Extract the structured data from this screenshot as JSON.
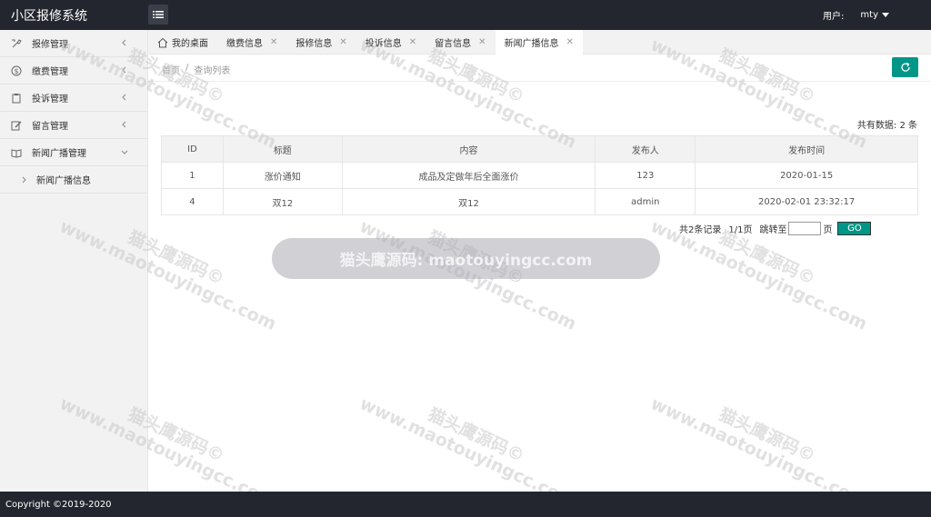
{
  "header": {
    "title": "小区报修系统",
    "user_label": "用户:",
    "user_name": "mty"
  },
  "sidebar": {
    "items": [
      {
        "label": "报修管理",
        "icon": "wrench-icon"
      },
      {
        "label": "缴费管理",
        "icon": "dollar-icon"
      },
      {
        "label": "投诉管理",
        "icon": "clipboard-icon"
      },
      {
        "label": "留言管理",
        "icon": "edit-icon"
      },
      {
        "label": "新闻广播管理",
        "icon": "book-icon"
      }
    ],
    "sub_item": "新闻广播信息"
  },
  "tabs": [
    {
      "label": "我的桌面"
    },
    {
      "label": "缴费信息"
    },
    {
      "label": "报修信息"
    },
    {
      "label": "投诉信息"
    },
    {
      "label": "留言信息"
    },
    {
      "label": "新闻广播信息"
    }
  ],
  "breadcrumb": {
    "home": "首页",
    "separator": "/",
    "current": "查询列表"
  },
  "summary": "共有数据: 2 条",
  "table": {
    "headers": [
      "ID",
      "标题",
      "内容",
      "发布人",
      "发布时间"
    ],
    "rows": [
      [
        "1",
        "涨价通知",
        "成品及定做年后全面涨价",
        "123",
        "2020-01-15"
      ],
      [
        "4",
        "双12",
        "双12",
        "admin",
        "2020-02-01 23:32:17"
      ]
    ]
  },
  "pager": {
    "records": "共2条记录",
    "pages": "1/1页",
    "jump": "跳转至",
    "page_suffix": "页",
    "go": "GO"
  },
  "watermark": {
    "cn": "猫头鹰源码©",
    "url": "www.maotouyingcc.com",
    "banner": "猫头鹰源码: maotouyingcc.com"
  },
  "footer": "Copyright ©2019-2020",
  "colors": {
    "accent": "#009688",
    "header_bg": "#23262e"
  }
}
